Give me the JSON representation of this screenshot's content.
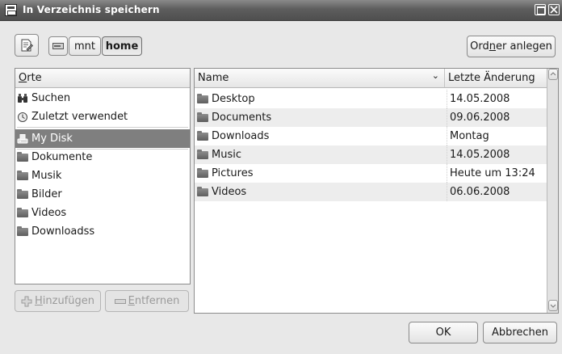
{
  "window": {
    "title": "In Verzeichnis speichern"
  },
  "pathbar": {
    "segments": [
      "mnt",
      "home"
    ]
  },
  "create_folder_button": {
    "pre": "Ord",
    "mn": "n",
    "post": "er anlegen"
  },
  "places": {
    "header_mn": "O",
    "header_rest": "rte",
    "items": [
      {
        "label": "Suchen",
        "icon": "binoculars-icon"
      },
      {
        "label": "Zuletzt verwendet",
        "icon": "recent-clock-icon"
      },
      {
        "label": "My Disk",
        "icon": "disk-icon",
        "selected": true
      },
      {
        "label": "Dokumente",
        "icon": "folder-icon"
      },
      {
        "label": "Musik",
        "icon": "folder-icon"
      },
      {
        "label": "Bilder",
        "icon": "folder-icon"
      },
      {
        "label": "Videos",
        "icon": "folder-icon"
      },
      {
        "label": "Downloadss",
        "icon": "folder-icon"
      }
    ]
  },
  "add_button": {
    "mn": "H",
    "rest": "inzufügen"
  },
  "remove_button": {
    "mn": "E",
    "rest": "ntfernen"
  },
  "files": {
    "columns": {
      "name": "Name",
      "modified": "Letzte Änderung"
    },
    "rows": [
      {
        "name": "Desktop",
        "modified": "14.05.2008"
      },
      {
        "name": "Documents",
        "modified": "09.06.2008"
      },
      {
        "name": "Downloads",
        "modified": "Montag"
      },
      {
        "name": "Music",
        "modified": "14.05.2008"
      },
      {
        "name": "Pictures",
        "modified": "Heute um 13:24"
      },
      {
        "name": "Videos",
        "modified": "06.06.2008"
      }
    ]
  },
  "dialog_buttons": {
    "ok": "OK",
    "cancel": "Abbrechen"
  },
  "colors": {
    "selection": "#7f7f7f",
    "titlebar": "#555555",
    "window_bg": "#e8e8e8"
  }
}
